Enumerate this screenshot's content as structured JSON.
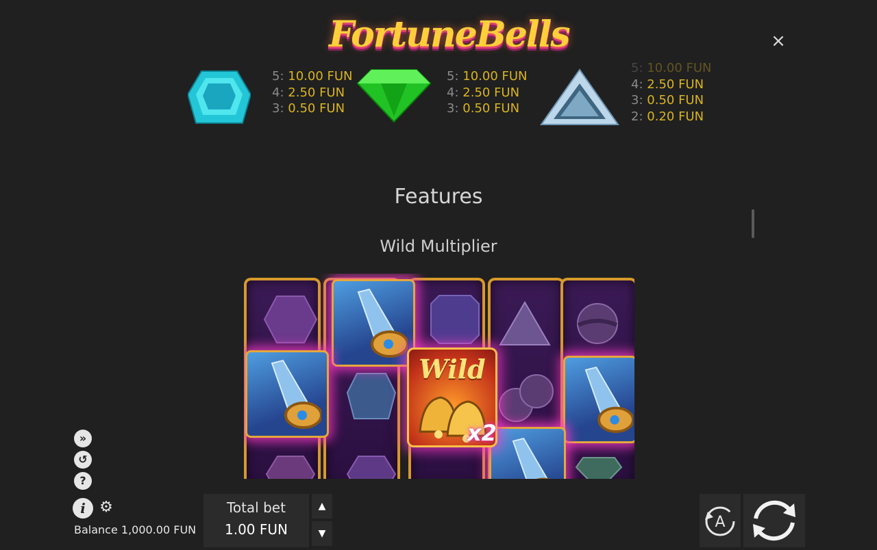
{
  "header": {
    "logo_text": "FortuneBells",
    "close_label": "×"
  },
  "paytable": [
    {
      "symbol": "cyan-gem",
      "lines": [
        {
          "count": "5:",
          "payout": "10.00 FUN"
        },
        {
          "count": "4:",
          "payout": "2.50 FUN"
        },
        {
          "count": "3:",
          "payout": "0.50 FUN"
        }
      ]
    },
    {
      "symbol": "green-gem",
      "lines": [
        {
          "count": "5:",
          "payout": "10.00 FUN"
        },
        {
          "count": "4:",
          "payout": "2.50 FUN"
        },
        {
          "count": "3:",
          "payout": "0.50 FUN"
        }
      ]
    },
    {
      "symbol": "white-triangle-gem",
      "lines": [
        {
          "count": "5:",
          "payout": "10.00 FUN"
        },
        {
          "count": "4:",
          "payout": "2.50 FUN"
        },
        {
          "count": "3:",
          "payout": "0.50 FUN"
        },
        {
          "count": "2:",
          "payout": "0.20 FUN"
        }
      ]
    }
  ],
  "features": {
    "title": "Features",
    "subtitle": "Wild Multiplier",
    "wild_label": "Wild",
    "multiplier_label": "x2"
  },
  "sidebar_icons": [
    "turbo-icon",
    "autoplay-history-icon",
    "help-icon"
  ],
  "footer": {
    "info_label": "i",
    "balance_text": "Balance 1,000.00 FUN",
    "bet_label": "Total bet",
    "bet_value": "1.00 FUN",
    "auto_label": "A"
  },
  "colors": {
    "background": "#202020",
    "payout_gold": "#d9b421",
    "frame_gold": "#d79a2a",
    "highlight_magenta": "#ff3fd8"
  }
}
